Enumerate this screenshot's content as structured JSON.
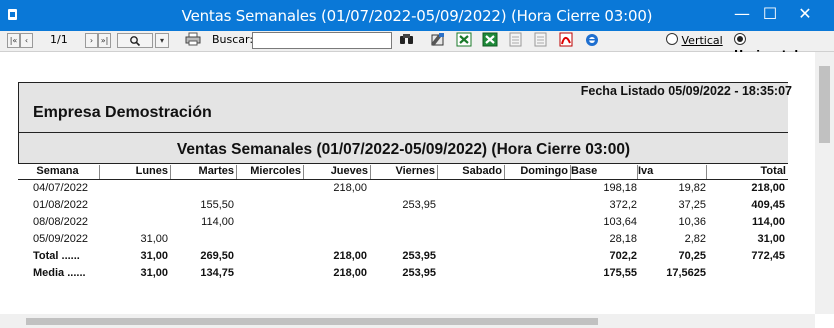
{
  "window": {
    "title": "Ventas Semanales   (01/07/2022-05/09/2022) (Hora Cierre 03:00)",
    "minimize": "—",
    "maximize": "☐",
    "close": "✕"
  },
  "toolbar": {
    "first": "|«",
    "prev": "‹",
    "page": "1/1",
    "next": "›",
    "last": "»|",
    "zoom_icon": "magnifier-icon",
    "zoom_dropdown": "▾",
    "print_icon": "printer-icon",
    "search_label": "Buscar:",
    "search_value": "",
    "find_icon": "binoculars-icon",
    "export_icons": [
      "export-icon",
      "excel-icon",
      "excel-icon",
      "document-icon",
      "document-icon",
      "pdf-icon",
      "browser-icon"
    ],
    "orientation_options": [
      "Vertical",
      "Horizontal"
    ],
    "orientation_selected": "Horizontal"
  },
  "report": {
    "fecha_listado": "Fecha Listado  05/09/2022 - 18:35:07",
    "empresa": "Empresa Demostración",
    "title": "Ventas Semanales   (01/07/2022-05/09/2022) (Hora Cierre 03:00)",
    "columns": [
      "Semana",
      "Lunes",
      "Martes",
      "Miercoles",
      "Jueves",
      "Viernes",
      "Sabado",
      "Domingo",
      "Base",
      "Iva",
      "Total"
    ],
    "rows": [
      {
        "semana": "04/07/2022",
        "lunes": "",
        "martes": "",
        "miercoles": "",
        "jueves": "218,00",
        "viernes": "",
        "sabado": "",
        "domingo": "",
        "base": "198,18",
        "iva": "19,82",
        "total": "218,00"
      },
      {
        "semana": "01/08/2022",
        "lunes": "",
        "martes": "155,50",
        "miercoles": "",
        "jueves": "",
        "viernes": "253,95",
        "sabado": "",
        "domingo": "",
        "base": "372,2",
        "iva": "37,25",
        "total": "409,45"
      },
      {
        "semana": "08/08/2022",
        "lunes": "",
        "martes": "114,00",
        "miercoles": "",
        "jueves": "",
        "viernes": "",
        "sabado": "",
        "domingo": "",
        "base": "103,64",
        "iva": "10,36",
        "total": "114,00"
      },
      {
        "semana": "05/09/2022",
        "lunes": "31,00",
        "martes": "",
        "miercoles": "",
        "jueves": "",
        "viernes": "",
        "sabado": "",
        "domingo": "",
        "base": "28,18",
        "iva": "2,82",
        "total": "31,00"
      }
    ],
    "total_row": {
      "semana": "Total ......",
      "lunes": "31,00",
      "martes": "269,50",
      "miercoles": "",
      "jueves": "218,00",
      "viernes": "253,95",
      "sabado": "",
      "domingo": "",
      "base": "702,2",
      "iva": "70,25",
      "total": "772,45"
    },
    "media_row": {
      "semana": "Media ......",
      "lunes": "31,00",
      "martes": "134,75",
      "miercoles": "",
      "jueves": "218,00",
      "viernes": "253,95",
      "sabado": "",
      "domingo": "",
      "base": "175,55",
      "iva": "17,5625",
      "total": ""
    }
  }
}
